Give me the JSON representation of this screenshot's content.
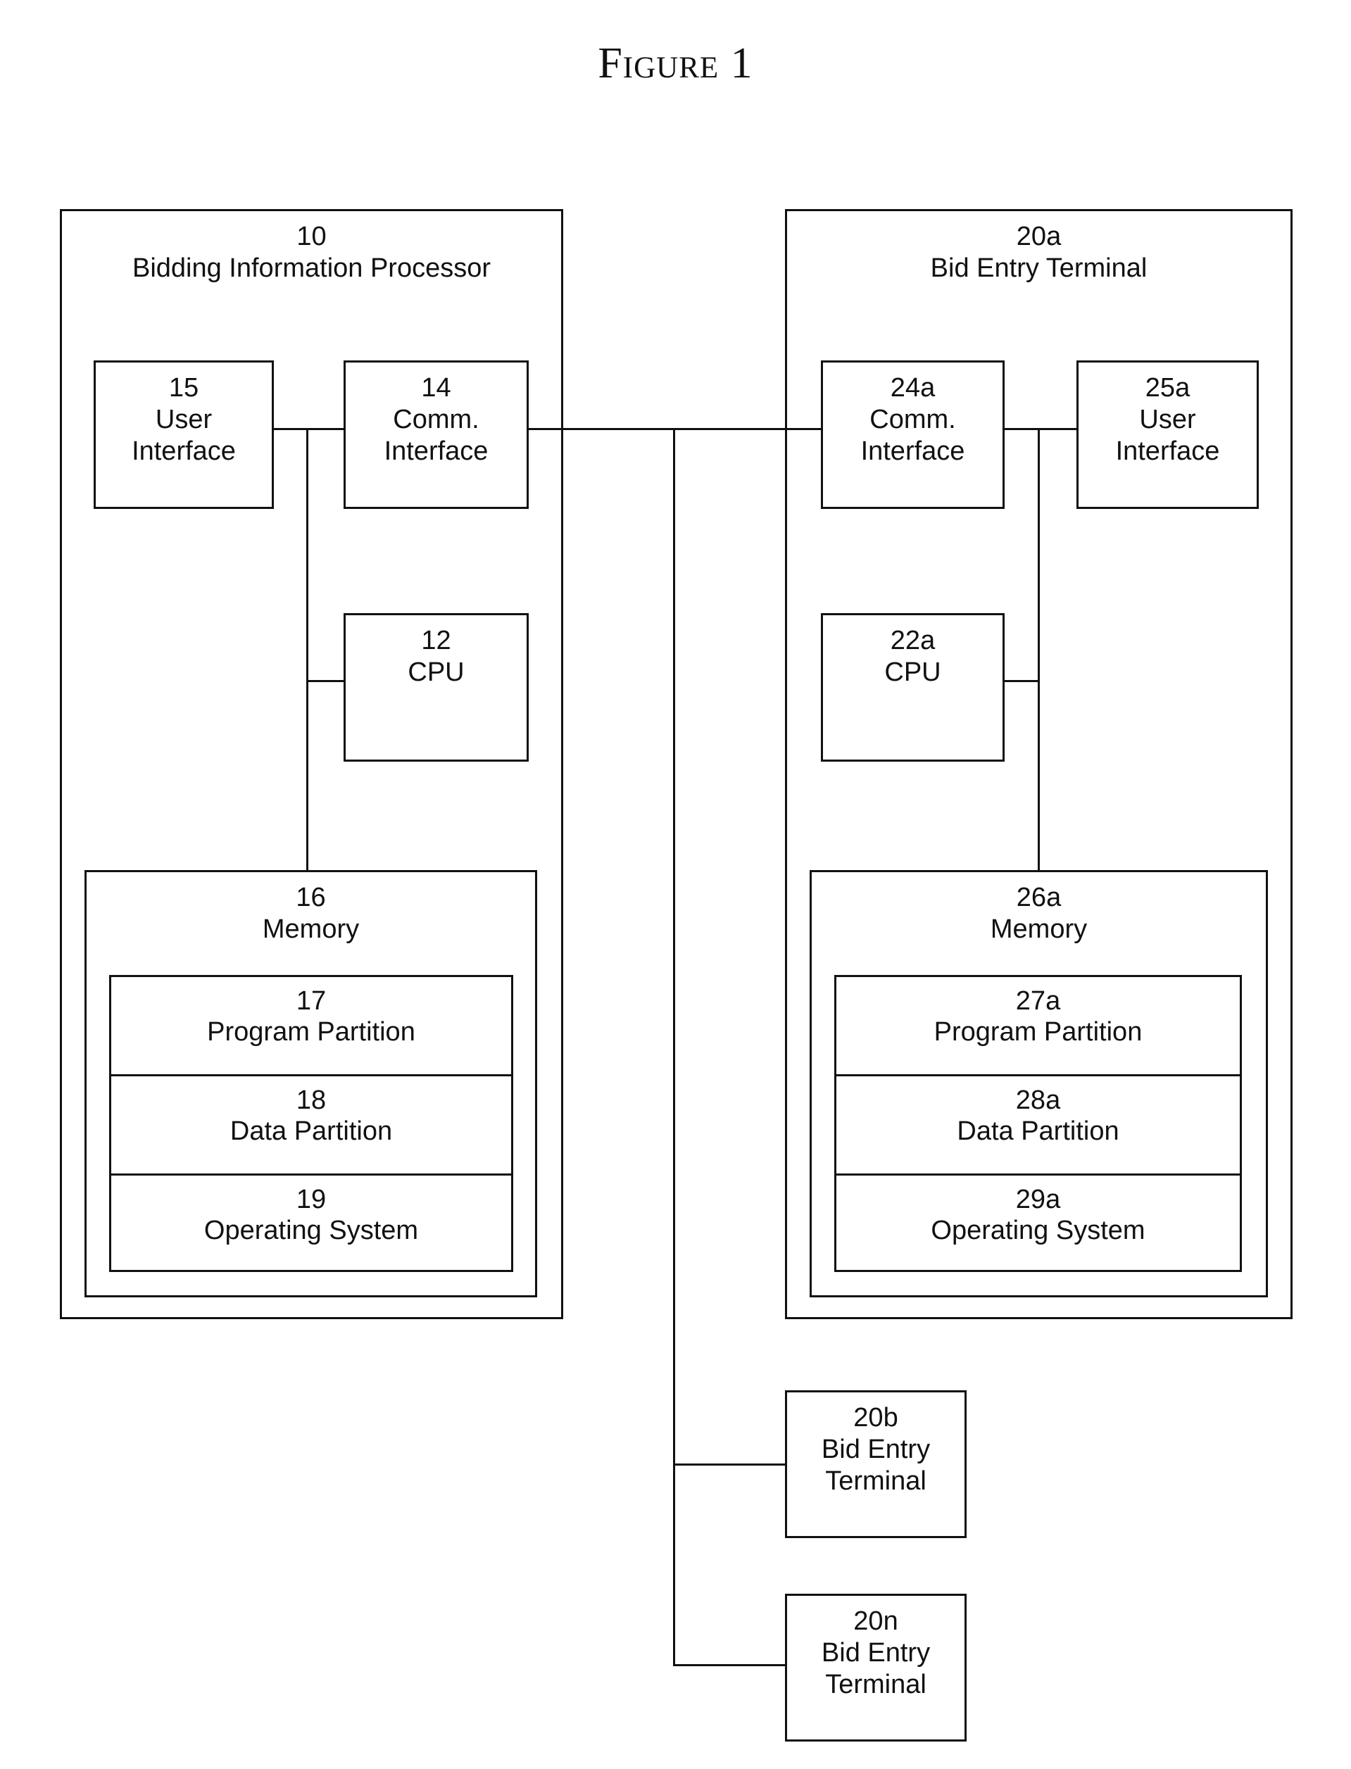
{
  "figure_title": "Figure 1",
  "processor": {
    "ref": "10",
    "name": "Bidding Information Processor",
    "user_interface": {
      "ref": "15",
      "line1": "User",
      "line2": "Interface"
    },
    "comm_interface": {
      "ref": "14",
      "line1": "Comm.",
      "line2": "Interface"
    },
    "cpu": {
      "ref": "12",
      "name": "CPU"
    },
    "memory": {
      "ref": "16",
      "name": "Memory",
      "partitions": [
        {
          "ref": "17",
          "name": "Program Partition"
        },
        {
          "ref": "18",
          "name": "Data Partition"
        },
        {
          "ref": "19",
          "name": "Operating System"
        }
      ]
    }
  },
  "terminal_a": {
    "ref": "20a",
    "name": "Bid Entry Terminal",
    "comm_interface": {
      "ref": "24a",
      "line1": "Comm.",
      "line2": "Interface"
    },
    "user_interface": {
      "ref": "25a",
      "line1": "User",
      "line2": "Interface"
    },
    "cpu": {
      "ref": "22a",
      "name": "CPU"
    },
    "memory": {
      "ref": "26a",
      "name": "Memory",
      "partitions": [
        {
          "ref": "27a",
          "name": "Program Partition"
        },
        {
          "ref": "28a",
          "name": "Data Partition"
        },
        {
          "ref": "29a",
          "name": "Operating System"
        }
      ]
    }
  },
  "terminal_b": {
    "ref": "20b",
    "line1": "Bid Entry",
    "line2": "Terminal"
  },
  "terminal_n": {
    "ref": "20n",
    "line1": "Bid Entry",
    "line2": "Terminal"
  }
}
